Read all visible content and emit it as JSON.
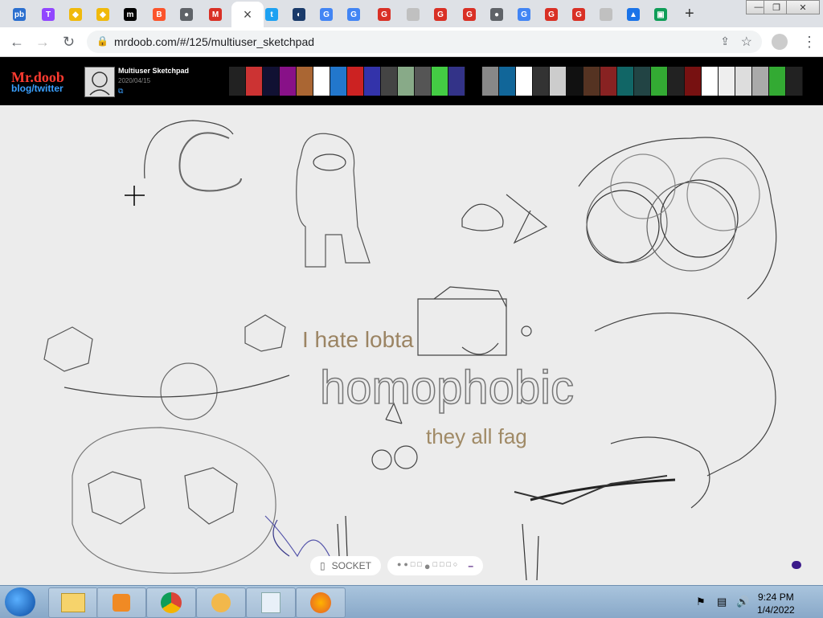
{
  "browser": {
    "tabs": [
      {
        "icon": "pb-icon",
        "color": "#2b6fcf",
        "label": "pb"
      },
      {
        "icon": "twitch-icon",
        "color": "#9146ff",
        "label": "T"
      },
      {
        "icon": "binance-icon",
        "color": "#f0b90b",
        "label": "◆"
      },
      {
        "icon": "binance-icon",
        "color": "#f0b90b",
        "label": "◆"
      },
      {
        "icon": "medium-icon",
        "color": "#000000",
        "label": "m"
      },
      {
        "icon": "brave-icon",
        "color": "#fb542b",
        "label": "B"
      },
      {
        "icon": "globe-icon",
        "color": "#5f6368",
        "label": "●"
      },
      {
        "icon": "gmail-icon",
        "color": "#d93025",
        "label": "M"
      },
      {
        "icon": "twitter-icon",
        "color": "#1da1f2",
        "label": "t"
      },
      {
        "icon": "app-icon",
        "color": "#1a3a6a",
        "label": "◐"
      },
      {
        "icon": "google-icon",
        "color": "#4285f4",
        "label": "G"
      },
      {
        "icon": "google-icon",
        "color": "#4285f4",
        "label": "G"
      },
      {
        "icon": "g-red-icon",
        "color": "#d93025",
        "label": "G"
      },
      {
        "icon": "blank-icon",
        "color": "#c0c0c0",
        "label": ""
      },
      {
        "icon": "g-red-icon",
        "color": "#d93025",
        "label": "G"
      },
      {
        "icon": "g-red-icon",
        "color": "#d93025",
        "label": "G"
      },
      {
        "icon": "globe-icon",
        "color": "#5f6368",
        "label": "●"
      },
      {
        "icon": "google-icon",
        "color": "#4285f4",
        "label": "G"
      },
      {
        "icon": "g-red-icon",
        "color": "#d93025",
        "label": "G"
      },
      {
        "icon": "g-red-icon",
        "color": "#d93025",
        "label": "G"
      },
      {
        "icon": "blank-icon",
        "color": "#c0c0c0",
        "label": ""
      },
      {
        "icon": "cloud-upload-icon",
        "color": "#1a73e8",
        "label": "▲"
      },
      {
        "icon": "sheet-icon",
        "color": "#0f9d58",
        "label": "▣"
      }
    ],
    "active_tab_close": "×",
    "new_tab": "+",
    "url": "mrdoob.com/#/125/multiuser_sketchpad"
  },
  "site": {
    "brand": "Mr.doob",
    "brand_sub": "blog/twitter",
    "post_title": "Multiuser Sketchpad",
    "post_date": "2020/04/15",
    "post_link_icon": "external-link-icon",
    "strip_colors": [
      "#222",
      "#c33",
      "#113",
      "#818",
      "#a63",
      "#fff",
      "#27c",
      "#c22",
      "#33a",
      "#444",
      "#8a8",
      "#555",
      "#4c4",
      "#338",
      "#000",
      "#888",
      "#169",
      "#fff",
      "#333",
      "#ccc",
      "#111",
      "#532",
      "#822",
      "#166",
      "#244",
      "#3a3",
      "#222",
      "#711",
      "#fff",
      "#eee",
      "#ddd",
      "#aaa",
      "#3a3",
      "#222"
    ]
  },
  "sketch": {
    "texts": [
      "I hate lobta",
      "homophobic",
      "they all fag"
    ]
  },
  "controls": {
    "socket_label": "SOCKET",
    "socket_icon": "socket-icon",
    "brush_sizes": [
      "●",
      "●",
      "□",
      "□",
      "●",
      "□",
      "□",
      "□",
      "○"
    ],
    "minus": "–"
  },
  "taskbar": {
    "time": "9:24 PM",
    "date": "1/4/2022",
    "apps": [
      "explorer",
      "media-player",
      "chrome",
      "keepass",
      "notepad",
      "firefox"
    ]
  }
}
